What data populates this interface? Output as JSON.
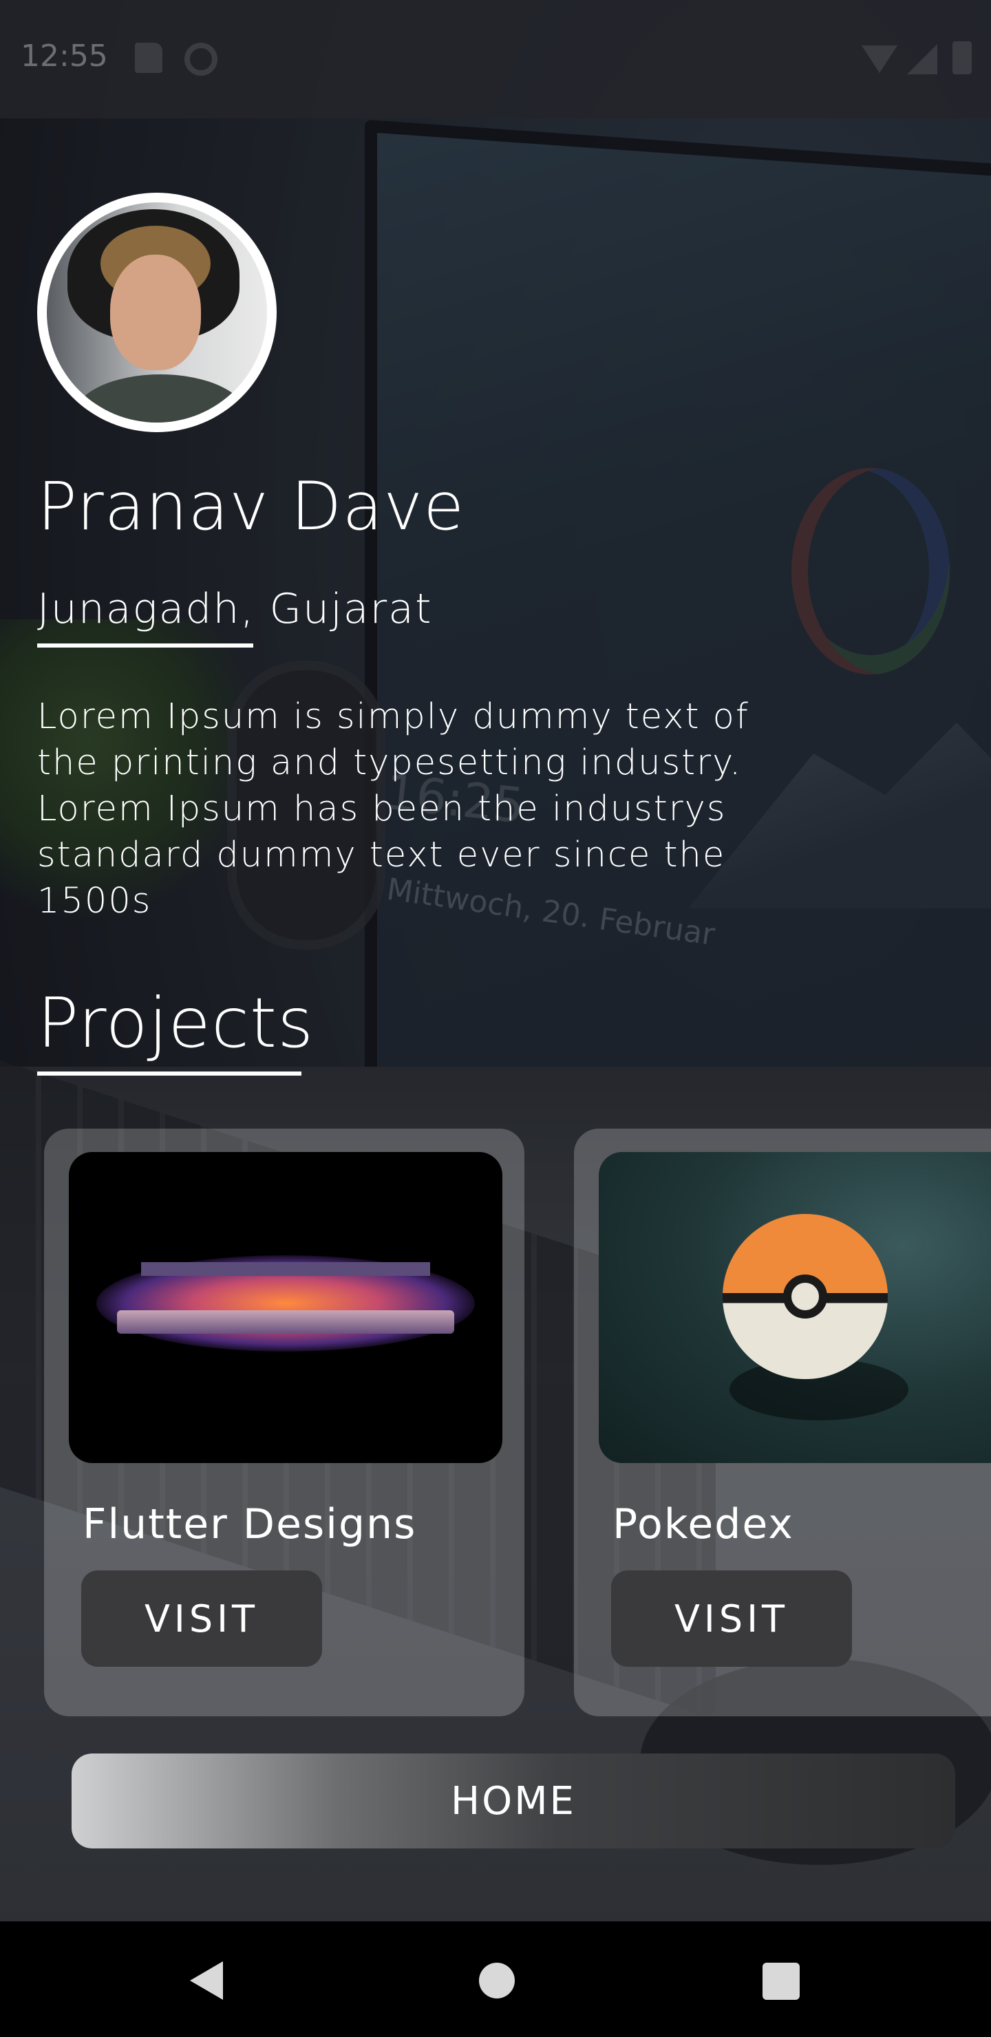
{
  "status_bar": {
    "time": "12:55",
    "icons": [
      "sd-card-icon",
      "at-sign-icon",
      "wifi-icon",
      "signal-icon",
      "battery-icon"
    ]
  },
  "profile": {
    "name": "Pranav Dave",
    "location": "Junagadh, Gujarat",
    "bio": "Lorem Ipsum is simply dummy text of the printing and typesetting industry. Lorem Ipsum has been the industrys standard dummy text ever since the 1500s"
  },
  "projects": {
    "title": "Projects",
    "items": [
      {
        "title": "Flutter Designs",
        "button": "VISIT",
        "image": "laptop-photo"
      },
      {
        "title": "Pokedex",
        "button": "VISIT",
        "image": "pokeball-photo"
      }
    ]
  },
  "home_button": "HOME",
  "background": {
    "date_line1": "16:25",
    "date_line2": "Mittwoch, 20. Februar"
  },
  "nav_bar": {
    "icons": [
      "back-icon",
      "home-circle-icon",
      "recent-apps-icon"
    ]
  },
  "colors": {
    "card_bg": "rgba(255,255,255,0.22)",
    "button_bg": "#3a3a3c",
    "text": "#ffffff"
  }
}
